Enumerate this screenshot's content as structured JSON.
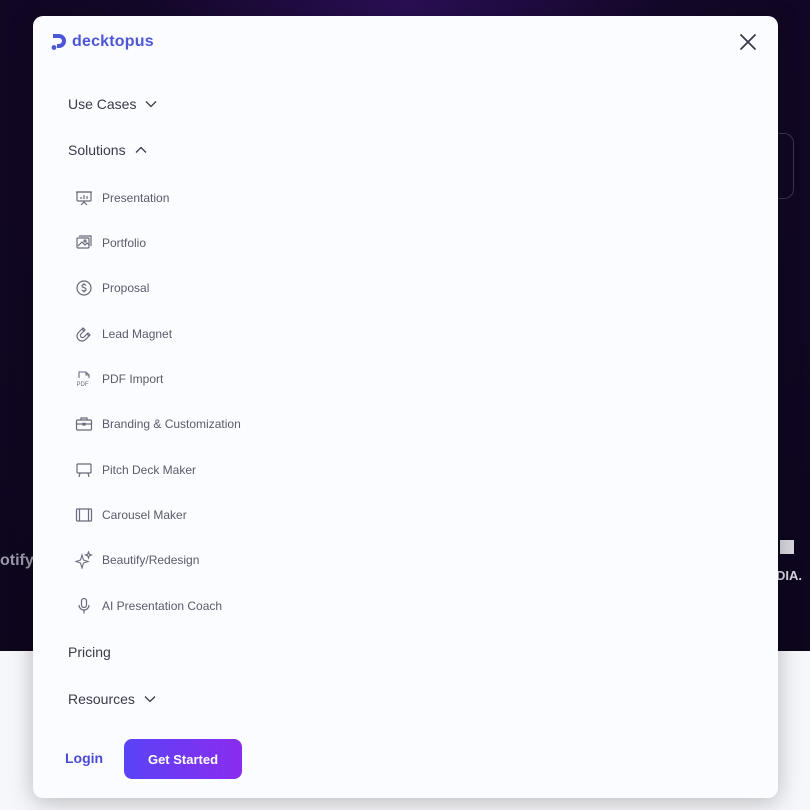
{
  "brand": {
    "name": "decktopus",
    "color": "#4c56d6"
  },
  "nav": {
    "use_cases": "Use Cases",
    "solutions": "Solutions",
    "pricing": "Pricing",
    "resources": "Resources"
  },
  "solutions_items": [
    {
      "label": "Presentation",
      "icon": "presentation-board-icon"
    },
    {
      "label": "Portfolio",
      "icon": "image-gallery-icon"
    },
    {
      "label": "Proposal",
      "icon": "dollar-circle-icon"
    },
    {
      "label": "Lead Magnet",
      "icon": "magnet-icon"
    },
    {
      "label": "PDF Import",
      "icon": "pdf-icon"
    },
    {
      "label": "Branding & Customization",
      "icon": "briefcase-icon"
    },
    {
      "label": "Pitch Deck Maker",
      "icon": "easel-icon"
    },
    {
      "label": "Carousel Maker",
      "icon": "carousel-icon"
    },
    {
      "label": "Beautify/Redesign",
      "icon": "sparkles-icon"
    },
    {
      "label": "AI Presentation Coach",
      "icon": "microphone-icon"
    }
  ],
  "pdf_icon_text": "PDF",
  "actions": {
    "login": "Login",
    "get_started": "Get Started"
  },
  "background": {
    "left_logo_fragment": "otify",
    "right_logo_fragment": "DIA.",
    "heading_fragment": "...............",
    "accent_gradient": [
      "#5a43f6",
      "#8a2cf0"
    ]
  }
}
